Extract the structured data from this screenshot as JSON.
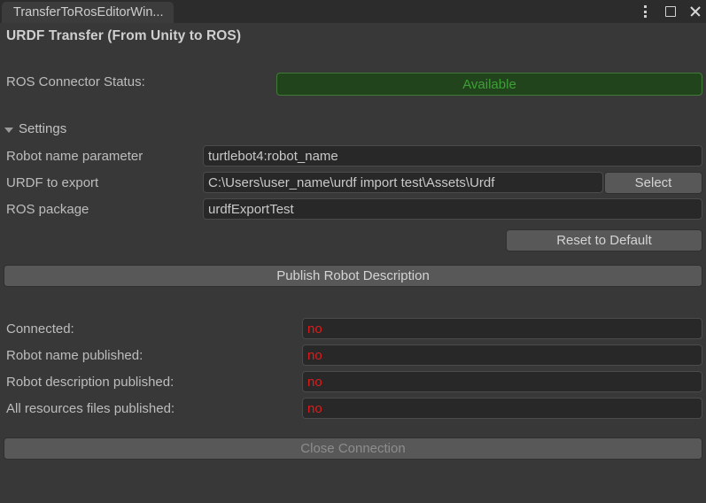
{
  "window": {
    "tab_title": "TransferToRosEditorWin...",
    "page_title": "URDF Transfer (From Unity to ROS)",
    "controls": {
      "menu": "kebab-menu-icon",
      "maximize": "maximize-icon",
      "close": "close-icon"
    }
  },
  "connector": {
    "label": "ROS Connector Status:",
    "status_value": "Available",
    "status_color": "#3ea037",
    "status_bg": "#22441d",
    "status_border": "#3f7a36"
  },
  "settings": {
    "foldout_label": "Settings",
    "expanded": true,
    "rows": [
      {
        "label": "Robot name parameter",
        "value": "turtlebot4:robot_name"
      },
      {
        "label": "URDF to export",
        "value": "C:\\Users\\user_name\\urdf import test\\Assets\\Urdf"
      },
      {
        "label": "ROS package",
        "value": "urdfExportTest"
      }
    ],
    "select_button": "Select",
    "reset_button": "Reset to Default"
  },
  "actions": {
    "publish_button": "Publish Robot Description",
    "close_connection_button": "Close Connection",
    "close_connection_enabled": false
  },
  "status": {
    "value_color": "#e01b1b",
    "rows": [
      {
        "label": "Connected:",
        "value": "no"
      },
      {
        "label": "Robot name published:",
        "value": "no"
      },
      {
        "label": "Robot description published:",
        "value": "no"
      },
      {
        "label": "All resources files published:",
        "value": "no"
      }
    ]
  }
}
